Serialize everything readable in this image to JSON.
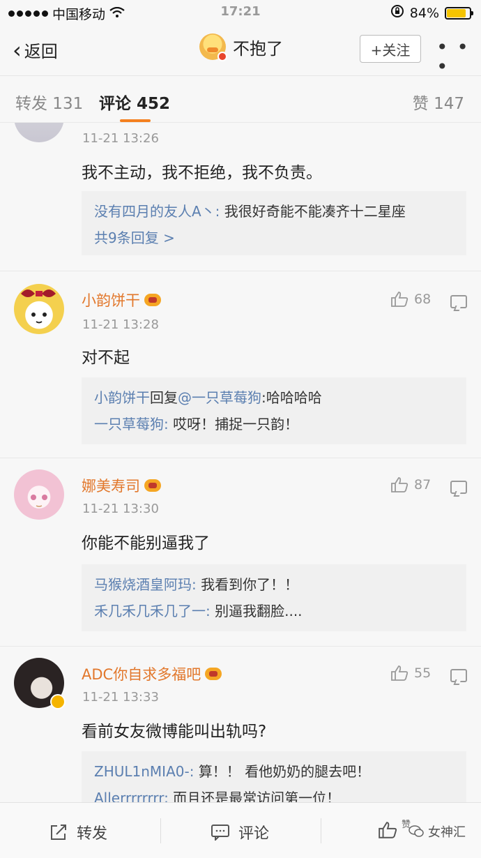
{
  "status_bar": {
    "carrier": "中国移动",
    "time": "17:21",
    "battery": "84%"
  },
  "nav": {
    "back_label": "返回",
    "title": "不抱了",
    "follow_label": "+关注",
    "more_label": "• • •"
  },
  "tabs": {
    "repost": "转发 131",
    "comments": "评论 452",
    "likes": "赞 147"
  },
  "comments": [
    {
      "username": "",
      "time": "11-21 13:26",
      "text": "我不主动，我不拒绝，我不负责。",
      "likes": "",
      "replies": [
        {
          "name": "没有四月的友人A丶:",
          "text": " 我很好奇能不能凑齐十二星座"
        }
      ],
      "more_replies": "共9条回复 >"
    },
    {
      "username": "小韵饼干",
      "time": "11-21 13:28",
      "text": "对不起",
      "likes": "68",
      "replies": [
        {
          "name": "小韵饼干",
          "text": "回复",
          "mention": "@一只草莓狗",
          "tail": ":哈哈哈哈"
        },
        {
          "name": "一只草莓狗:",
          "text": " 哎呀！捕捉一只韵！"
        }
      ]
    },
    {
      "username": "娜美寿司",
      "time": "11-21 13:30",
      "text": "你能不能别逼我了",
      "likes": "87",
      "replies": [
        {
          "name": "马猴烧酒皇阿玛:",
          "text": " 我看到你了！！"
        },
        {
          "name": "禾几禾几禾几了一:",
          "text": " 别逼我翻脸...."
        }
      ]
    },
    {
      "username": "ADC你自求多福吧",
      "time": "11-21 13:33",
      "text": "看前女友微博能叫出轨吗?",
      "likes": "55",
      "replies": [
        {
          "name": "ZHUL1nMIA0-:",
          "text": " 算！！ 看他奶奶的腿去吧！"
        },
        {
          "name": "Allerrrrrrrr:",
          "text": " 而且还是最常访问第一位！"
        }
      ]
    }
  ],
  "bottom_bar": {
    "repost": "转发",
    "comment": "评论",
    "like": "赞",
    "watermark": "女神汇"
  },
  "colors": {
    "accent": "#f4801f",
    "username": "#e2772b",
    "link": "#5b7fb0"
  }
}
